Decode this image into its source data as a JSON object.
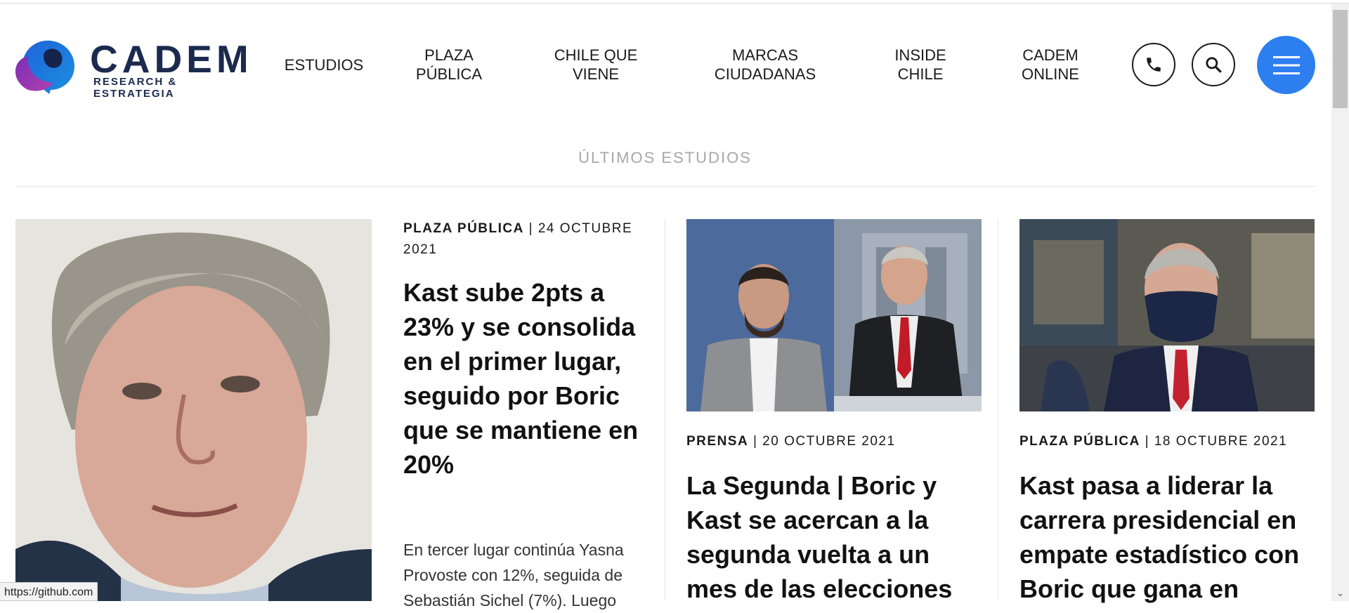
{
  "brand": {
    "name": "CADEM",
    "tagline": "RESEARCH & ESTRATEGIA",
    "primary_color": "#1b2a4e",
    "accent_color": "#2d7ff0"
  },
  "nav": [
    {
      "label": "ESTUDIOS"
    },
    {
      "label": "PLAZA\nPÚBLICA"
    },
    {
      "label": "CHILE QUE\nVIENE"
    },
    {
      "label": "MARCAS\nCIUDADANAS"
    },
    {
      "label": "INSIDE\nCHILE"
    },
    {
      "label": "CADEM\nONLINE"
    }
  ],
  "actions": {
    "phone_icon": "phone-icon",
    "search_icon": "search-icon",
    "menu_icon": "hamburger-icon"
  },
  "section": {
    "title": "ÚLTIMOS ESTUDIOS"
  },
  "articles": [
    {
      "category": "PLAZA PÚBLICA",
      "date": "| 24 OCTUBRE 2021",
      "title": "Kast sube 2pts a 23% y se consolida en el primer lugar, seguido por Boric que se mantiene en 20%",
      "excerpt": "En tercer lugar continúa Yasna Provoste con 12%, seguida de Sebastián Sichel (7%). Luego"
    },
    {
      "category": "PRENSA",
      "date": "| 20 OCTUBRE 2021",
      "title": "La Segunda | Boric y Kast se acercan a la segunda vuelta a un mes de las elecciones"
    },
    {
      "category": "PLAZA PÚBLICA",
      "date": "| 18 OCTUBRE 2021",
      "title": "Kast pasa a liderar la carrera presidencial en empate estadístico con Boric que gana en"
    }
  ],
  "status_bar": {
    "url": "https://github.com"
  }
}
